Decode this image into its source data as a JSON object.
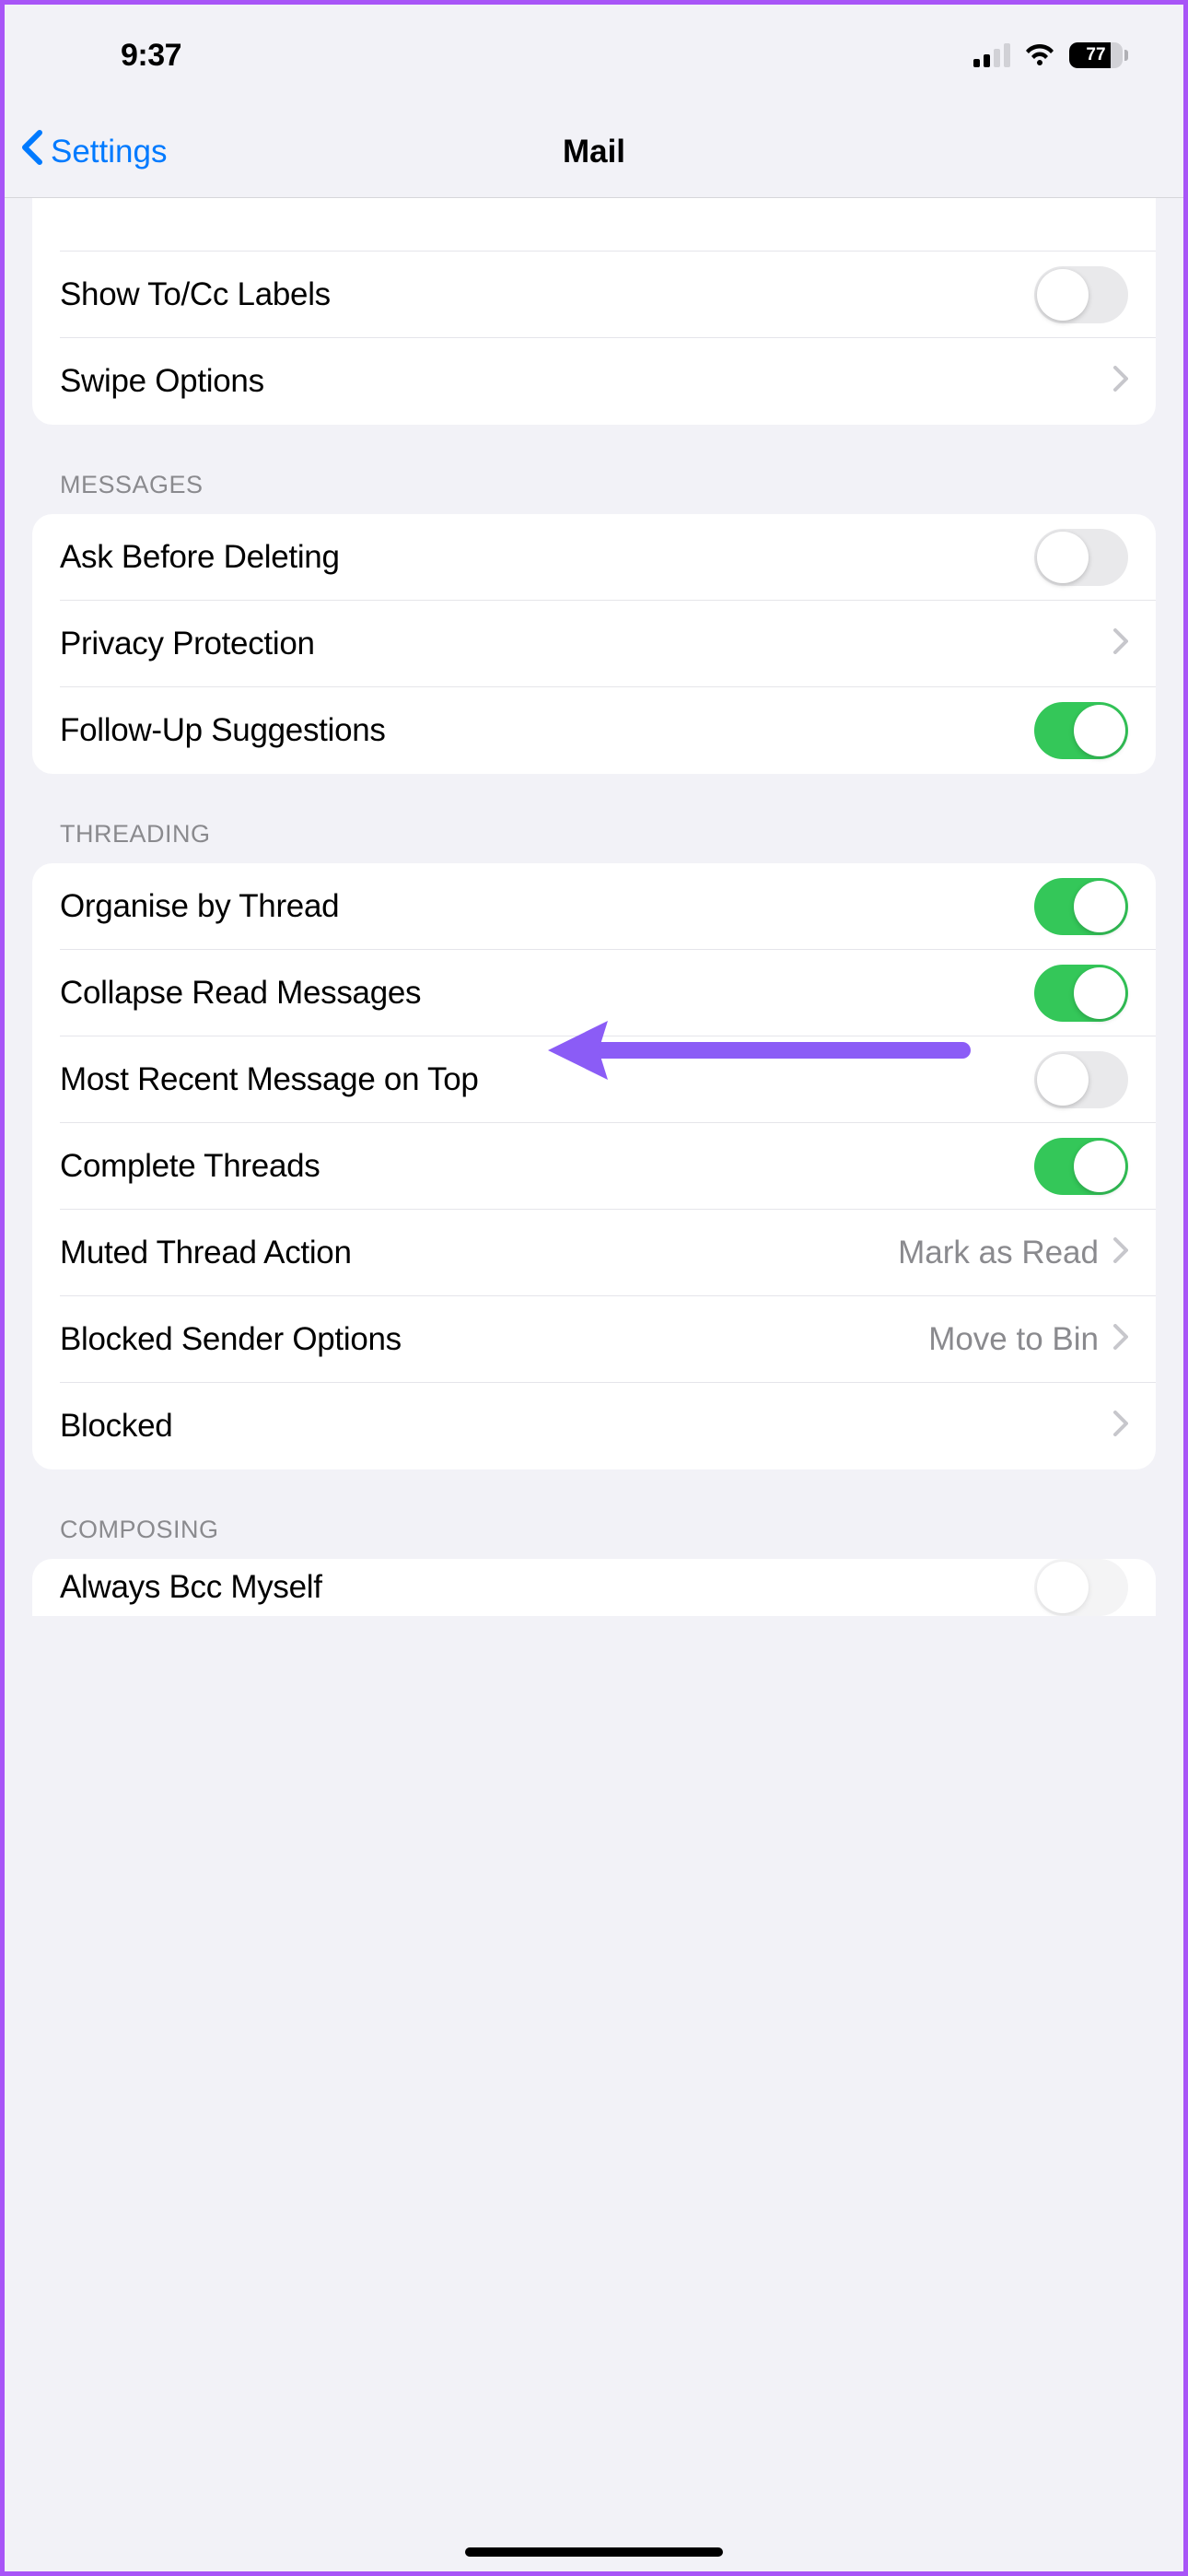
{
  "statusBar": {
    "time": "9:37",
    "batteryPercent": "77"
  },
  "nav": {
    "back": "Settings",
    "title": "Mail"
  },
  "sections": {
    "first": {
      "rows": [
        {
          "label": "Show To/Cc Labels",
          "type": "toggle",
          "on": false
        },
        {
          "label": "Swipe Options",
          "type": "disclosure"
        }
      ]
    },
    "messages": {
      "header": "MESSAGES",
      "rows": [
        {
          "label": "Ask Before Deleting",
          "type": "toggle",
          "on": false
        },
        {
          "label": "Privacy Protection",
          "type": "disclosure"
        },
        {
          "label": "Follow-Up Suggestions",
          "type": "toggle",
          "on": true
        }
      ]
    },
    "threading": {
      "header": "THREADING",
      "rows": [
        {
          "label": "Organise by Thread",
          "type": "toggle",
          "on": true
        },
        {
          "label": "Collapse Read Messages",
          "type": "toggle",
          "on": true
        },
        {
          "label": "Most Recent Message on Top",
          "type": "toggle",
          "on": false
        },
        {
          "label": "Complete Threads",
          "type": "toggle",
          "on": true
        },
        {
          "label": "Muted Thread Action",
          "type": "value-disclosure",
          "value": "Mark as Read"
        },
        {
          "label": "Blocked Sender Options",
          "type": "value-disclosure",
          "value": "Move to Bin"
        },
        {
          "label": "Blocked",
          "type": "disclosure"
        }
      ]
    },
    "composing": {
      "header": "COMPOSING",
      "rows": [
        {
          "label": "Always Bcc Myself",
          "type": "toggle",
          "on": false
        }
      ]
    }
  },
  "annotation": {
    "arrowColor": "#8b5cf6"
  }
}
